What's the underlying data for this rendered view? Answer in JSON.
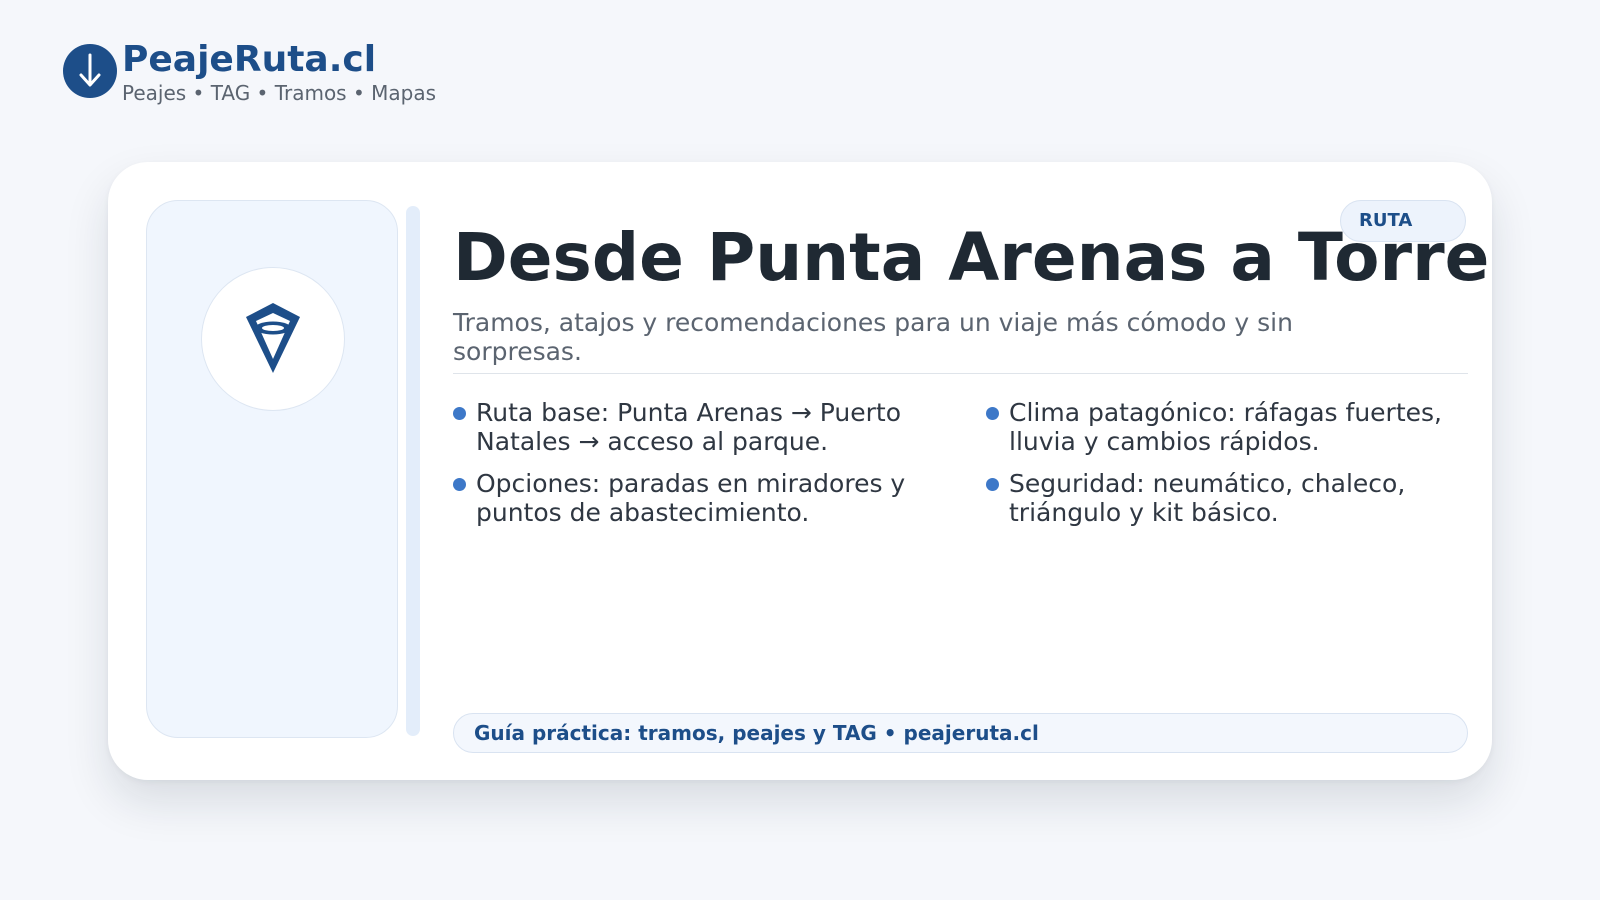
{
  "brand": {
    "name": "PeajeRuta.cl",
    "tagline": "Peajes • TAG • Tramos • Mapas",
    "logo_icon": "arrow-down-icon",
    "color": "#1d4e89"
  },
  "card": {
    "badge": "RUTA",
    "emblem_icon": "location-pin-icon",
    "title": "Desde Punta Arenas a Torres del Paine",
    "subtitle": "Tramos, atajos y recomendaciones para un viaje más cómodo y sin sorpresas.",
    "bullets_left": [
      "Ruta base: Punta Arenas → Puerto Natales → acceso al parque.",
      "Opciones: paradas en miradores y puntos de abastecimiento."
    ],
    "bullets_right": [
      "Clima patagónico: ráfagas fuertes, lluvia y cambios rápidos.",
      "Seguridad: neumático, chaleco, triángulo y kit básico."
    ],
    "footer": "Guía práctica: tramos, peajes y TAG • peajeruta.cl"
  },
  "colors": {
    "accent": "#1d4e89",
    "bullet": "#3d78c8",
    "background": "#f5f7fb"
  }
}
